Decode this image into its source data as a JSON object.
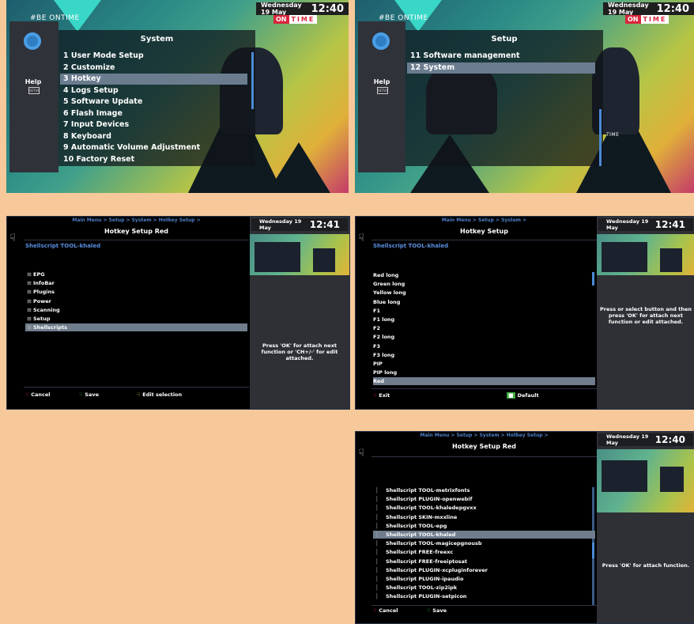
{
  "tv_top_left": {
    "channel_text": "#BE ONTIME",
    "clock_date": "Wednesday 19 May",
    "clock_time": "12:40",
    "logo_on": "ON",
    "logo_time": "TIME",
    "logo_sub": "SPORTS",
    "help_label": "Help",
    "help_btn": "SETUP",
    "menu_title": "System",
    "items": [
      "1 User Mode Setup",
      "2 Customize",
      "3 Hotkey",
      "4 Logs Setup",
      "5 Software Update",
      "6 Flash Image",
      "7 Input Devices",
      "8 Keyboard",
      "9 Automatic Volume Adjustment",
      "10 Factory Reset"
    ],
    "selected_index": 2
  },
  "tv_top_right": {
    "channel_text": "#BE ONTIME",
    "clock_date": "Wednesday 19 May",
    "clock_time": "12:40",
    "logo_on": "ON",
    "logo_time": "TIME",
    "logo_sub": "SPORTS",
    "help_label": "Help",
    "help_btn": "SETUP",
    "menu_title": "Setup",
    "items": [
      "11 Software management",
      "12 System"
    ],
    "selected_index": 1,
    "ticker_label": "TIME"
  },
  "hotkey_red_1": {
    "breadcrumb": "Main Menu > Setup > System > Hotkey Setup >",
    "title": "Hotkey Setup Red",
    "subtitle": "Shellscript TOOL-khaled",
    "items": [
      "EPG",
      "InfoBar",
      "Plugins",
      "Power",
      "Scanning",
      "Setup",
      "Shellscripts"
    ],
    "selected_index": 6,
    "clock_date": "Wednesday 19 May",
    "clock_time": "12:41",
    "message": "Press 'OK' for attach next function or 'CH+/-' for edit attached.",
    "footer": {
      "cancel": "Cancel",
      "save": "Save",
      "edit": "Edit selection"
    }
  },
  "hotkey_setup": {
    "breadcrumb": "Main Menu > Setup > System >",
    "title": "Hotkey Setup",
    "subtitle": "Shellscript TOOL-khaled",
    "items": [
      "Red long",
      "Green long",
      "Yellow long",
      "Blue long",
      "F1",
      "F1 long",
      "F2",
      "F2 long",
      "F3",
      "F3 long",
      "PIP",
      "PIP long",
      "Red"
    ],
    "selected_index": 12,
    "clock_date": "Wednesday 19 May",
    "clock_time": "12:41",
    "message": "Press or select button and then press 'OK' for attach next function or edit attached.",
    "footer": {
      "exit": "Exit",
      "default": "Default"
    }
  },
  "hotkey_red_2": {
    "breadcrumb": "Main Menu > Setup > System > Hotkey Setup >",
    "title": "Hotkey Setup Red",
    "items": [
      "Shellscript TOOL-metrixfonts",
      "Shellscript PLUGIN-openwebif",
      "Shellscript TOOL-khaledepgvxx",
      "Shellscript SKIN-mxxline",
      "Shellscript TOOL-epg",
      "Shellscript TOOL-khaled",
      "Shellscript TOOL-magicepgnousb",
      "Shellscript FREE-freexc",
      "Shellscript FREE-freeiptosat",
      "Shellscript PLUGIN-xcpluginforever",
      "Shellscript PLUGIN-ipaudio",
      "Shellscript TOOL-zip2ipk",
      "Shellscript PLUGIN-setpicon"
    ],
    "selected_index": 5,
    "clock_date": "Wednesday 19 May",
    "clock_time": "12:40",
    "message": "Press 'OK' for attach function.",
    "footer": {
      "cancel": "Cancel",
      "save": "Save"
    }
  },
  "colors": {
    "peach": "#f7c99a",
    "selection": "#6b7c8f",
    "breadcrumb_blue": "#4d7ec6",
    "red": "#d8263c",
    "green": "#3faa3f",
    "yellow": "#d8c23a"
  },
  "icons": [
    "gear-icon",
    "help-setup-icon",
    "hand-icon",
    "red-button-icon",
    "green-button-icon",
    "yellow-button-icon",
    "expand-plus-icon"
  ]
}
